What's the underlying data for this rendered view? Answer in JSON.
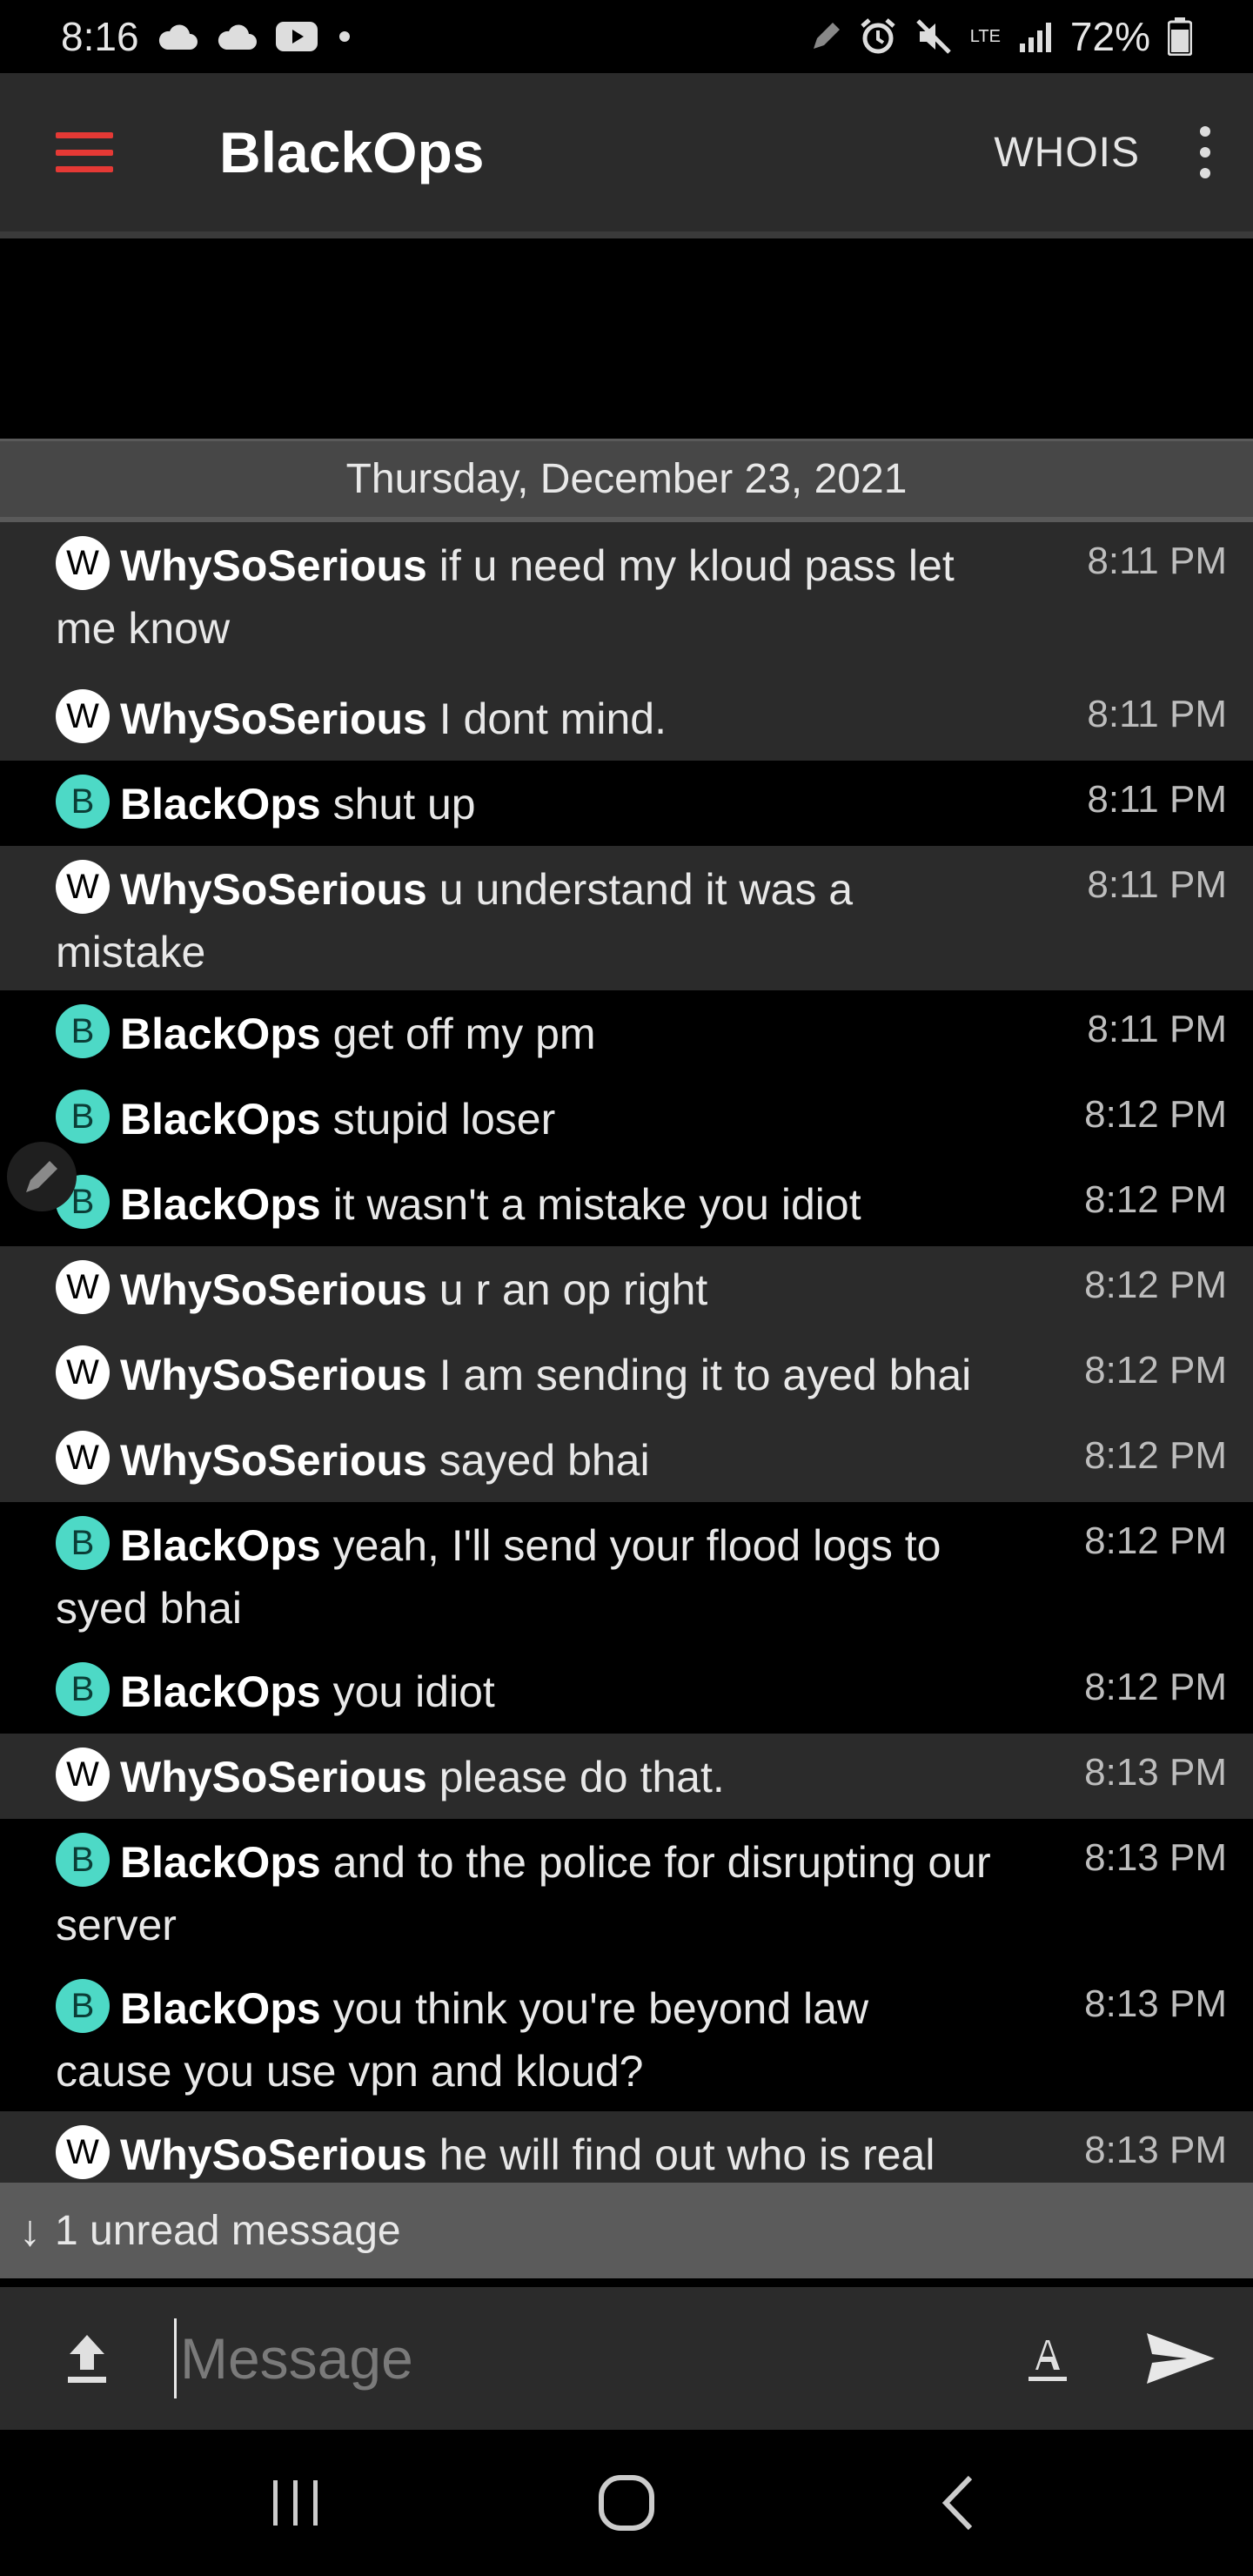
{
  "status_bar": {
    "time": "8:16",
    "battery": "72%",
    "network": "LTE"
  },
  "app_bar": {
    "title": "BlackOps",
    "whois_label": "WHOIS"
  },
  "date_separator": "Thursday, December 23, 2021",
  "messages": [
    {
      "avatar": "W",
      "nick": "WhySoSerious",
      "text": "if u need my kloud pass let me know",
      "time": "8:11 PM"
    },
    {
      "avatar": "W",
      "nick": "WhySoSerious",
      "text": "I dont mind.",
      "time": "8:11 PM"
    },
    {
      "avatar": "B",
      "nick": "BlackOps",
      "text": "shut up",
      "time": "8:11 PM"
    },
    {
      "avatar": "W",
      "nick": "WhySoSerious",
      "text": "u understand it was a mistake",
      "time": "8:11 PM"
    },
    {
      "avatar": "B",
      "nick": "BlackOps",
      "text": "get off my pm",
      "time": "8:11 PM"
    },
    {
      "avatar": "B",
      "nick": "BlackOps",
      "text": "stupid loser",
      "time": "8:12 PM"
    },
    {
      "avatar": "B",
      "nick": "BlackOps",
      "text": "it wasn't a mistake you idiot",
      "time": "8:12 PM"
    },
    {
      "avatar": "W",
      "nick": "WhySoSerious",
      "text": "u r an op right",
      "time": "8:12 PM"
    },
    {
      "avatar": "W",
      "nick": "WhySoSerious",
      "text": "I am sending it to ayed bhai",
      "time": "8:12 PM"
    },
    {
      "avatar": "W",
      "nick": "WhySoSerious",
      "text": "sayed bhai",
      "time": "8:12 PM"
    },
    {
      "avatar": "B",
      "nick": "BlackOps",
      "text": "yeah, I'll send your flood logs to syed bhai",
      "time": "8:12 PM"
    },
    {
      "avatar": "B",
      "nick": "BlackOps",
      "text": "you idiot",
      "time": "8:12 PM"
    },
    {
      "avatar": "W",
      "nick": "WhySoSerious",
      "text": "please do that.",
      "time": "8:13 PM"
    },
    {
      "avatar": "B",
      "nick": "BlackOps",
      "text": "and to the police for disrupting our server",
      "time": "8:13 PM"
    },
    {
      "avatar": "B",
      "nick": "BlackOps",
      "text": "you think you're beyond law cause you use vpn and kloud?",
      "time": "8:13 PM"
    },
    {
      "avatar": "W",
      "nick": "WhySoSerious",
      "text": "he will find out who is real",
      "time": "8:13 PM"
    }
  ],
  "unread_banner": {
    "arrow": "↓",
    "text": "1 unread message"
  },
  "composer": {
    "placeholder": "Message"
  }
}
